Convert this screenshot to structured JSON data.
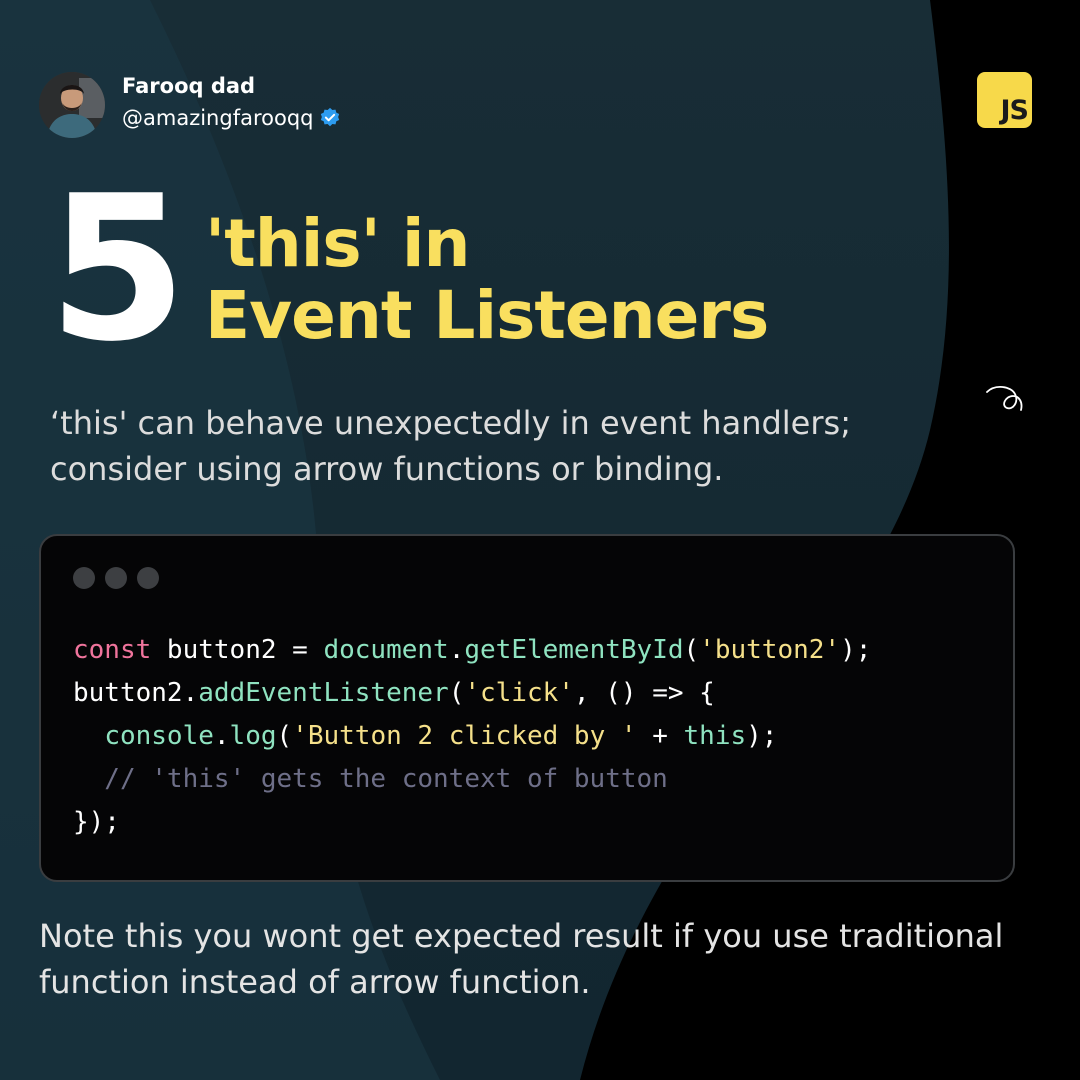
{
  "author": {
    "name": "Farooq dad",
    "handle": "@amazingfarooqq",
    "verified": true
  },
  "badge": {
    "label": "JS",
    "color": "#f7d94a"
  },
  "heading": {
    "number": "5",
    "title_line1": "'this' in",
    "title_line2": "Event Listeners"
  },
  "subtitle_line1": "‘this' can behave unexpectedly in event handlers;",
  "subtitle_line2": "consider using arrow functions or binding.",
  "code": {
    "lines": [
      [
        {
          "t": "const",
          "c": "kw"
        },
        {
          "t": " button2 = ",
          "c": "plain"
        },
        {
          "t": "document",
          "c": "obj"
        },
        {
          "t": ".",
          "c": "plain"
        },
        {
          "t": "getElementById",
          "c": "obj"
        },
        {
          "t": "(",
          "c": "plain"
        },
        {
          "t": "'button2'",
          "c": "str"
        },
        {
          "t": ");",
          "c": "plain"
        }
      ],
      [
        {
          "t": "button2.",
          "c": "plain"
        },
        {
          "t": "addEventListener",
          "c": "obj"
        },
        {
          "t": "(",
          "c": "plain"
        },
        {
          "t": "'click'",
          "c": "str"
        },
        {
          "t": ", () => {",
          "c": "plain"
        }
      ],
      [
        {
          "t": "  ",
          "c": "plain"
        },
        {
          "t": "console",
          "c": "obj"
        },
        {
          "t": ".",
          "c": "plain"
        },
        {
          "t": "log",
          "c": "obj"
        },
        {
          "t": "(",
          "c": "plain"
        },
        {
          "t": "'Button 2 clicked by '",
          "c": "str"
        },
        {
          "t": " + ",
          "c": "plain"
        },
        {
          "t": "this",
          "c": "obj"
        },
        {
          "t": ");",
          "c": "plain"
        }
      ],
      [
        {
          "t": "  // 'this' gets the context of button",
          "c": "cm"
        }
      ],
      [
        {
          "t": "});",
          "c": "plain"
        }
      ]
    ]
  },
  "note_line1": "Note this you wont get expected result if you use traditional",
  "note_line2": "function instead of arrow function.",
  "colors": {
    "background": "#000000",
    "panel": "#152a33",
    "accent_yellow": "#f9df5f",
    "keyword": "#f0749c",
    "object": "#8fe3c0",
    "string": "#f5e08a",
    "comment": "#6e6f88"
  },
  "icons": {
    "verified": "verified-badge-icon",
    "swirl": "swirl-doodle-icon",
    "window_dots": "window-control-dots"
  }
}
